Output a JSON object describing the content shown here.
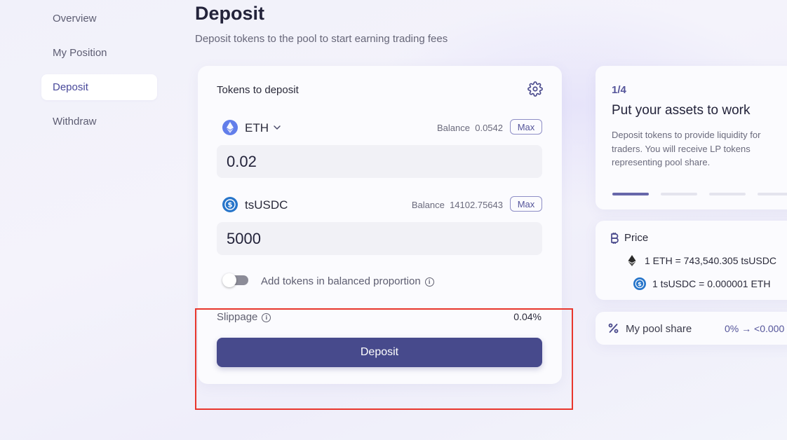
{
  "sidebar": {
    "items": [
      {
        "label": "Overview"
      },
      {
        "label": "My Position"
      },
      {
        "label": "Deposit",
        "active": true
      },
      {
        "label": "Withdraw"
      }
    ]
  },
  "header": {
    "title": "Deposit",
    "subtitle": "Deposit tokens to the pool to start earning trading fees"
  },
  "deposit_card": {
    "heading": "Tokens to deposit",
    "token_a": {
      "name": "ETH",
      "balance_label": "Balance",
      "balance": "0.0542",
      "max_label": "Max",
      "amount": "0.02",
      "icon": "eth-icon"
    },
    "token_b": {
      "name": "tsUSDC",
      "balance_label": "Balance",
      "balance": "14102.75643",
      "max_label": "Max",
      "amount": "5000",
      "icon": "usdc-icon"
    },
    "balanced_toggle": {
      "label": "Add tokens in balanced proportion",
      "on": false
    },
    "slippage": {
      "label": "Slippage",
      "value": "0.04%"
    },
    "submit_label": "Deposit"
  },
  "steps": {
    "counter": "1/4",
    "title": "Put your assets to work",
    "description": "Deposit tokens to provide liquidity for traders. You will receive LP tokens representing pool share.",
    "total": 4,
    "current": 1
  },
  "price": {
    "title": "Price",
    "rate_a": "1 ETH = 743,540.305 tsUSDC",
    "rate_b": "1 tsUSDC = 0.000001 ETH"
  },
  "pool_share": {
    "label": "My pool share",
    "value": "0% → <0.000"
  },
  "colors": {
    "accent": "#474a8c",
    "highlight_box": "#e8362c"
  }
}
